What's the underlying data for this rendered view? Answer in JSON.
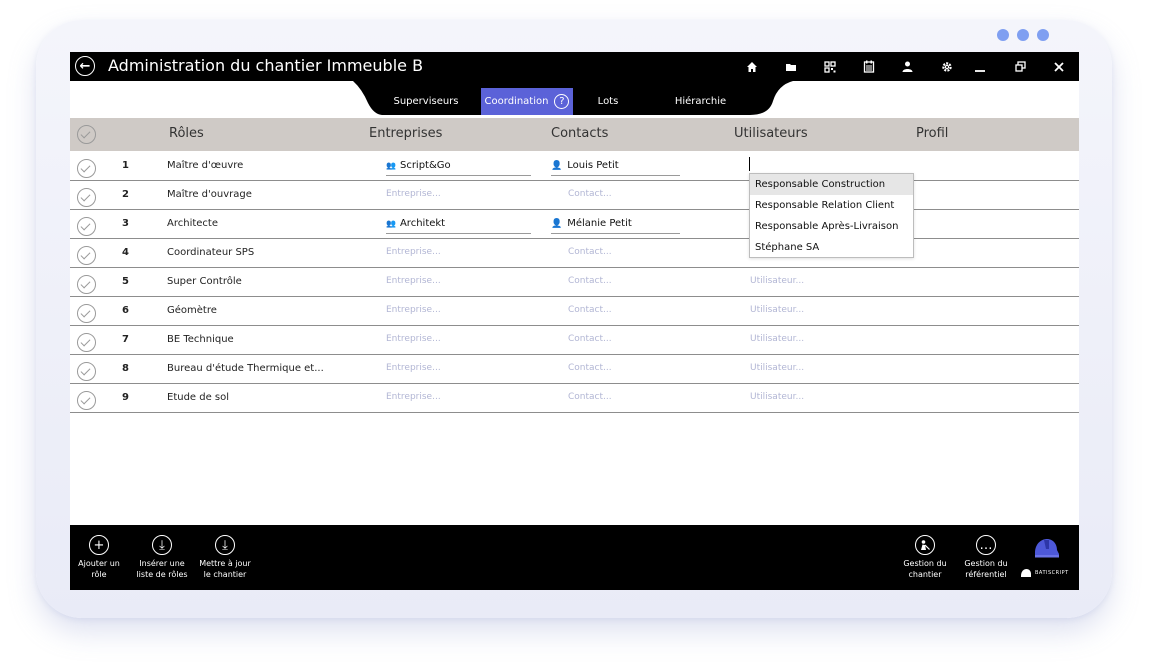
{
  "window": {
    "title": "Administration du chantier Immeuble B",
    "toolbar_icons": [
      "home-icon",
      "folder-icon",
      "grid-icon",
      "calendar-icon",
      "user-icon",
      "gear-icon"
    ],
    "controls": [
      "minimize",
      "restore",
      "close"
    ]
  },
  "tabs": [
    {
      "label": "Superviseurs",
      "active": false
    },
    {
      "label": "Coordination",
      "active": true,
      "icon": "?"
    },
    {
      "label": "Lots",
      "active": false
    },
    {
      "label": "Hiérarchie",
      "active": false
    }
  ],
  "table": {
    "columns": [
      "Rôles",
      "Entreprises",
      "Contacts",
      "Utilisateurs",
      "Profil"
    ],
    "placeholders": {
      "entreprise": "Entreprise...",
      "contact": "Contact...",
      "utilisateur": "Utilisateur..."
    },
    "rows": [
      {
        "num": "1",
        "role": "Maître d'œuvre",
        "entreprise": "Script&Go",
        "contact": "Louis Petit",
        "utilisateur": ""
      },
      {
        "num": "2",
        "role": "Maître d'ouvrage",
        "entreprise": "",
        "contact": "",
        "utilisateur": ""
      },
      {
        "num": "3",
        "role": "Architecte",
        "entreprise": "Architekt",
        "contact": "Mélanie Petit",
        "utilisateur": ""
      },
      {
        "num": "4",
        "role": "Coordinateur SPS",
        "entreprise": "",
        "contact": "",
        "utilisateur": ""
      },
      {
        "num": "5",
        "role": "Super Contrôle",
        "entreprise": "",
        "contact": "",
        "utilisateur": ""
      },
      {
        "num": "6",
        "role": "Géomètre",
        "entreprise": "",
        "contact": "",
        "utilisateur": ""
      },
      {
        "num": "7",
        "role": "BE Technique",
        "entreprise": "",
        "contact": "",
        "utilisateur": ""
      },
      {
        "num": "8",
        "role": "Bureau d'étude Thermique et...",
        "entreprise": "",
        "contact": "",
        "utilisateur": ""
      },
      {
        "num": "9",
        "role": "Etude de sol",
        "entreprise": "",
        "contact": "",
        "utilisateur": ""
      }
    ]
  },
  "dropdown": {
    "items": [
      "Responsable  Construction",
      "Responsable  Relation Client",
      "Responsable Après-Livraison",
      "Stéphane SA"
    ],
    "highlighted": 0
  },
  "bottom_bar": {
    "left": [
      {
        "label": "Ajouter un\nrôle",
        "icon": "+"
      },
      {
        "label": "Insérer une\nliste de rôles",
        "icon": "⤓"
      },
      {
        "label": "Mettre à jour\nle chantier",
        "icon": "⤓"
      }
    ],
    "right": [
      {
        "label": "Gestion du\nchantier",
        "icon": "worker-icon"
      },
      {
        "label": "Gestion du\nréférentiel",
        "icon": "…"
      }
    ],
    "brand": "BATISCRIPT"
  },
  "colors": {
    "accent": "#5b62d8",
    "header_bg": "#cfcac6",
    "dots": "#7f9ff1",
    "placeholder": "#b2b6d4"
  }
}
